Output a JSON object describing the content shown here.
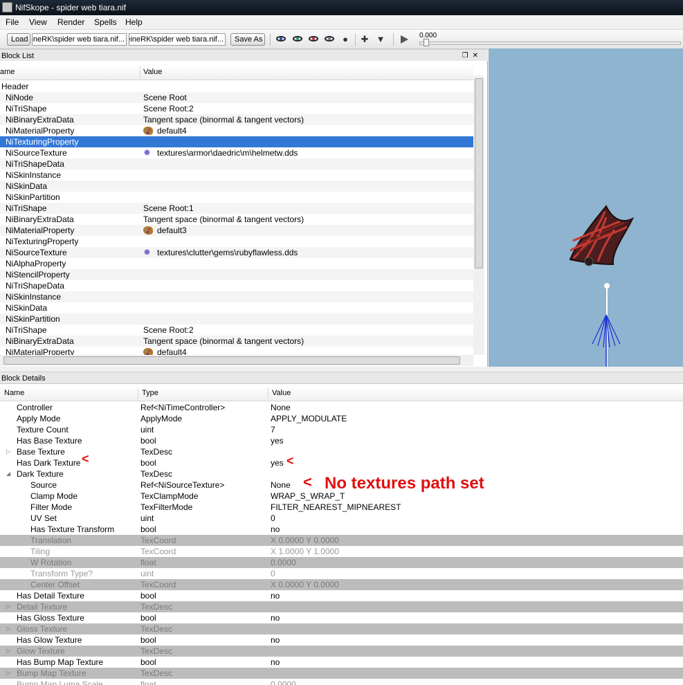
{
  "window": {
    "title": "NifSkope - spider web tiara.nif"
  },
  "menu": [
    "File",
    "View",
    "Render",
    "Spells",
    "Help"
  ],
  "toolbar": {
    "load_label": "Load",
    "load_path": "...eineRK\\spider web tiara.nif",
    "save_path": "...eineRK\\spider web tiara.nif",
    "save_as_label": "Save As",
    "time_value": "0.000"
  },
  "block_list": {
    "panel_title": "Block List",
    "columns": [
      "ame",
      "Value"
    ],
    "rows": [
      {
        "name": "Header",
        "value": "",
        "icon": "",
        "indent": 0
      },
      {
        "name": "NiNode",
        "value": "Scene Root",
        "icon": "",
        "indent": 1
      },
      {
        "name": "NiTriShape",
        "value": "Scene Root:2",
        "icon": "",
        "indent": 1
      },
      {
        "name": "NiBinaryExtraData",
        "value": "Tangent space (binormal & tangent vectors)",
        "icon": "",
        "indent": 1
      },
      {
        "name": "NiMaterialProperty",
        "value": "default4",
        "icon": "palette",
        "indent": 1
      },
      {
        "name": "NiTexturingProperty",
        "value": "",
        "icon": "",
        "indent": 1,
        "selected": true
      },
      {
        "name": "NiSourceTexture",
        "value": "textures\\armor\\daedric\\m\\helmetw.dds",
        "icon": "texture",
        "indent": 1
      },
      {
        "name": "NiTriShapeData",
        "value": "",
        "icon": "",
        "indent": 1
      },
      {
        "name": "NiSkinInstance",
        "value": "",
        "icon": "",
        "indent": 1
      },
      {
        "name": "NiSkinData",
        "value": "",
        "icon": "",
        "indent": 1
      },
      {
        "name": "NiSkinPartition",
        "value": "",
        "icon": "",
        "indent": 1
      },
      {
        "name": "NiTriShape",
        "value": "Scene Root:1",
        "icon": "",
        "indent": 1
      },
      {
        "name": "NiBinaryExtraData",
        "value": "Tangent space (binormal & tangent vectors)",
        "icon": "",
        "indent": 1
      },
      {
        "name": "NiMaterialProperty",
        "value": "default3",
        "icon": "palette",
        "indent": 1
      },
      {
        "name": "NiTexturingProperty",
        "value": "",
        "icon": "",
        "indent": 1
      },
      {
        "name": "NiSourceTexture",
        "value": "textures\\clutter\\gems\\rubyflawless.dds",
        "icon": "texture",
        "indent": 1
      },
      {
        "name": "NiAlphaProperty",
        "value": "",
        "icon": "",
        "indent": 1
      },
      {
        "name": "NiStencilProperty",
        "value": "",
        "icon": "",
        "indent": 1
      },
      {
        "name": "NiTriShapeData",
        "value": "",
        "icon": "",
        "indent": 1
      },
      {
        "name": "NiSkinInstance",
        "value": "",
        "icon": "",
        "indent": 1
      },
      {
        "name": "NiSkinData",
        "value": "",
        "icon": "",
        "indent": 1
      },
      {
        "name": "NiSkinPartition",
        "value": "",
        "icon": "",
        "indent": 1
      },
      {
        "name": "NiTriShape",
        "value": "Scene Root:2",
        "icon": "",
        "indent": 1
      },
      {
        "name": "NiBinaryExtraData",
        "value": "Tangent space (binormal & tangent vectors)",
        "icon": "",
        "indent": 1
      },
      {
        "name": "NiMaterialProperty",
        "value": "default4",
        "icon": "palette",
        "indent": 1
      }
    ]
  },
  "block_details": {
    "panel_title": "Block Details",
    "columns": [
      "Name",
      "Type",
      "Value"
    ],
    "rows": [
      {
        "name": "Controller",
        "type": "Ref<NiTimeController>",
        "value": "None",
        "level": 1
      },
      {
        "name": "Apply Mode",
        "type": "ApplyMode",
        "value": "APPLY_MODULATE",
        "level": 1
      },
      {
        "name": "Texture Count",
        "type": "uint",
        "value": "7",
        "level": 1
      },
      {
        "name": "Has Base Texture",
        "type": "bool",
        "value": "yes",
        "level": 1
      },
      {
        "name": "Base Texture",
        "type": "TexDesc",
        "value": "",
        "level": 1,
        "expander": "collapsed"
      },
      {
        "name": "Has Dark Texture",
        "type": "bool",
        "value": "yes",
        "level": 1
      },
      {
        "name": "Dark Texture",
        "type": "TexDesc",
        "value": "",
        "level": 1,
        "expander": "expanded"
      },
      {
        "name": "Source",
        "type": "Ref<NiSourceTexture>",
        "value": "None",
        "level": 2
      },
      {
        "name": "Clamp Mode",
        "type": "TexClampMode",
        "value": "WRAP_S_WRAP_T",
        "level": 2
      },
      {
        "name": "Filter Mode",
        "type": "TexFilterMode",
        "value": "FILTER_NEAREST_MIPNEAREST",
        "level": 2
      },
      {
        "name": "UV Set",
        "type": "uint",
        "value": "0",
        "level": 2
      },
      {
        "name": "Has Texture Transform",
        "type": "bool",
        "value": "no",
        "level": 2
      },
      {
        "name": "Translation",
        "type": "TexCoord",
        "value": "X 0.0000 Y 0.0000",
        "level": 2,
        "state": "disabled-shaded"
      },
      {
        "name": "Tiling",
        "type": "TexCoord",
        "value": "X 1.0000 Y 1.0000",
        "level": 2,
        "state": "disabled"
      },
      {
        "name": "W Rotation",
        "type": "float",
        "value": "0.0000",
        "level": 2,
        "state": "disabled-shaded"
      },
      {
        "name": "Transform Type?",
        "type": "uint",
        "value": "0",
        "level": 2,
        "state": "disabled"
      },
      {
        "name": "Center Offset",
        "type": "TexCoord",
        "value": "X 0.0000 Y 0.0000",
        "level": 2,
        "state": "disabled-shaded"
      },
      {
        "name": "Has Detail Texture",
        "type": "bool",
        "value": "no",
        "level": 1
      },
      {
        "name": "Detail Texture",
        "type": "TexDesc",
        "value": "",
        "level": 1,
        "expander": "collapsed",
        "state": "disabled-shaded"
      },
      {
        "name": "Has Gloss Texture",
        "type": "bool",
        "value": "no",
        "level": 1
      },
      {
        "name": "Gloss Texture",
        "type": "TexDesc",
        "value": "",
        "level": 1,
        "expander": "collapsed",
        "state": "disabled-shaded"
      },
      {
        "name": "Has Glow Texture",
        "type": "bool",
        "value": "no",
        "level": 1
      },
      {
        "name": "Glow Texture",
        "type": "TexDesc",
        "value": "",
        "level": 1,
        "expander": "collapsed",
        "state": "disabled-shaded"
      },
      {
        "name": "Has Bump Map Texture",
        "type": "bool",
        "value": "no",
        "level": 1
      },
      {
        "name": "Bump Map Texture",
        "type": "TexDesc",
        "value": "",
        "level": 1,
        "expander": "collapsed",
        "state": "disabled-shaded"
      },
      {
        "name": "Bump Map Luma Scale",
        "type": "float",
        "value": "0.0000",
        "level": 1,
        "state": "disabled"
      }
    ]
  },
  "annotations": {
    "arrow_glyph": "<",
    "note": "No textures path set",
    "color": "#e01010"
  },
  "viewport": {
    "background": "#8fb4cf"
  }
}
